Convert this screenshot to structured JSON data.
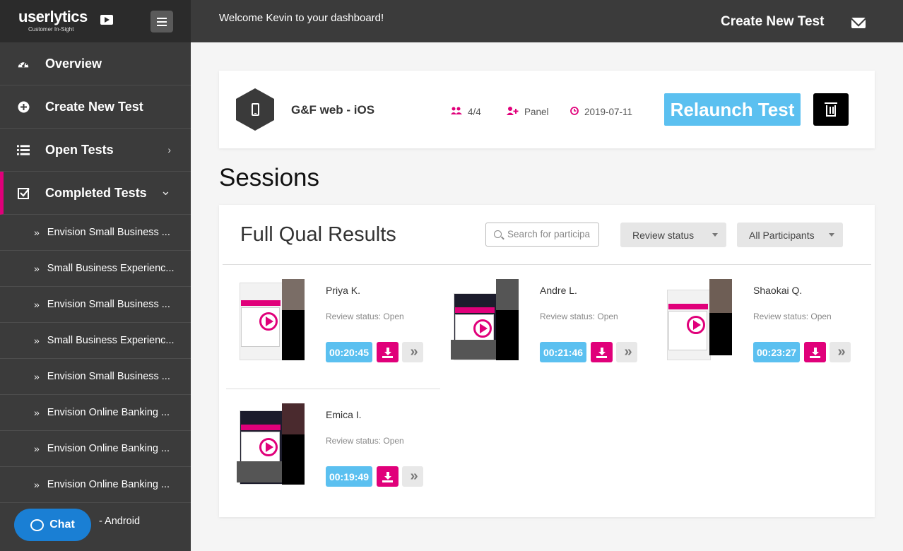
{
  "brand": {
    "name": "userlytics",
    "tagline": "Customer In-Sight"
  },
  "topbar": {
    "welcome": "Welcome Kevin to your dashboard!",
    "create_label": "Create New Test"
  },
  "sidebar": {
    "main": [
      {
        "label": "Overview",
        "icon": "dashboard-icon"
      },
      {
        "label": "Create New Test",
        "icon": "plus-circle-icon"
      },
      {
        "label": "Open Tests",
        "icon": "list-icon",
        "chevron": "›"
      },
      {
        "label": "Completed Tests",
        "icon": "check-square-icon",
        "chevron": "⌄"
      }
    ],
    "sub_items": [
      "Envision Small Business ...",
      "Small Business Experienc...",
      "Envision Small Business ...",
      "Small Business Experienc...",
      "Envision Small Business ...",
      "Envision Online Banking ...",
      "Envision Online Banking ...",
      "Envision Online Banking ...",
      "- Android"
    ]
  },
  "chat": {
    "label": "Chat"
  },
  "test": {
    "name": "G&F web - iOS",
    "participants": "4/4",
    "source": "Panel",
    "date": "2019-07-11",
    "relaunch_label": "Relaunch Test"
  },
  "sessions_title": "Sessions",
  "results": {
    "title": "Full Qual Results",
    "search_placeholder": "Search for participa",
    "filter_review": "Review status",
    "filter_participants": "All Participants",
    "sessions": [
      {
        "name": "Priya K.",
        "status": "Review status: Open",
        "duration": "00:20:45"
      },
      {
        "name": "Andre L.",
        "status": "Review status: Open",
        "duration": "00:21:46"
      },
      {
        "name": "Shaokai Q.",
        "status": "Review status: Open",
        "duration": "00:23:27"
      },
      {
        "name": "Emica I.",
        "status": "Review status: Open",
        "duration": "00:19:49"
      }
    ]
  },
  "colors": {
    "accent_pink": "#e0007a",
    "accent_blue": "#5bc0f0",
    "sidebar_bg": "#3b3b3b",
    "chat_blue": "#1a7fd4"
  }
}
